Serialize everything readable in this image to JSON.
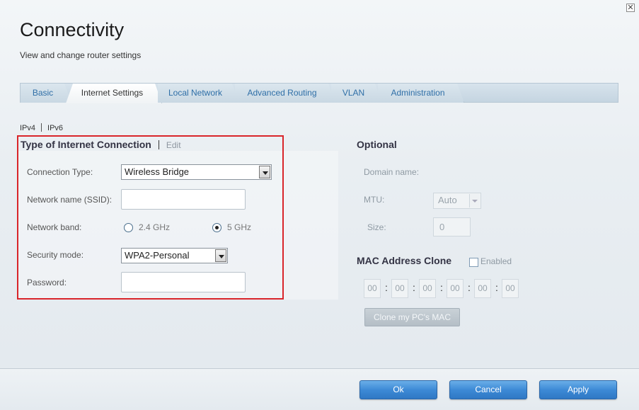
{
  "window": {
    "close_symbol": "✕"
  },
  "header": {
    "title": "Connectivity",
    "subtitle": "View and change router settings"
  },
  "tabs": [
    {
      "label": "Basic",
      "active": false
    },
    {
      "label": "Internet Settings",
      "active": true
    },
    {
      "label": "Local Network",
      "active": false
    },
    {
      "label": "Advanced Routing",
      "active": false
    },
    {
      "label": "VLAN",
      "active": false
    },
    {
      "label": "Administration",
      "active": false
    }
  ],
  "ip_versions": {
    "ipv4": "IPv4",
    "ipv6": "IPv6"
  },
  "connection": {
    "title": "Type of Internet Connection",
    "edit": "Edit",
    "connection_type_label": "Connection Type:",
    "connection_type_value": "Wireless Bridge",
    "ssid_label": "Network name (SSID):",
    "ssid_value": "",
    "band_label": "Network band:",
    "band_options": [
      "2.4 GHz",
      "5 GHz"
    ],
    "band_selected": "5 GHz",
    "security_label": "Security mode:",
    "security_value": "WPA2-Personal",
    "password_label": "Password:",
    "password_value": ""
  },
  "optional": {
    "title": "Optional",
    "domain_label": "Domain name:",
    "mtu_label": "MTU:",
    "mtu_value": "Auto",
    "size_label": "Size:",
    "size_value": "0"
  },
  "mac_clone": {
    "title": "MAC Address Clone",
    "enabled_label": "Enabled",
    "enabled": false,
    "octets": [
      "00",
      "00",
      "00",
      "00",
      "00",
      "00"
    ],
    "separator": ":",
    "clone_button": "Clone my PC's MAC"
  },
  "footer": {
    "ok": "Ok",
    "cancel": "Cancel",
    "apply": "Apply"
  },
  "colors": {
    "accent_blue": "#3d8ad6",
    "highlight_red": "#d9252a",
    "tab_text": "#2f6fa7"
  }
}
